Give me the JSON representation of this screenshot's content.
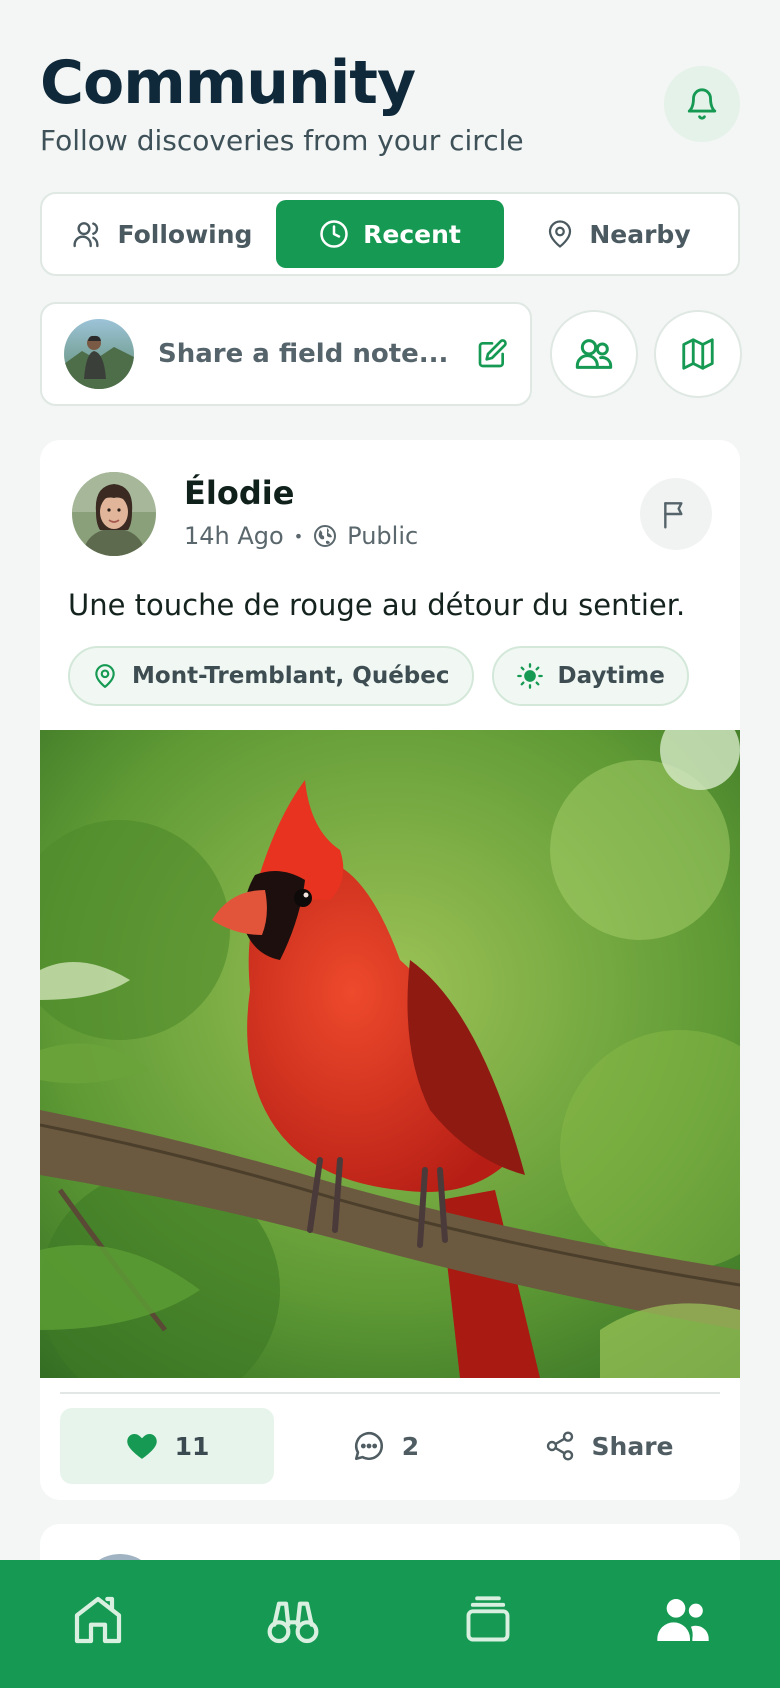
{
  "header": {
    "title": "Community",
    "subtitle": "Follow discoveries from your circle",
    "bell_icon": "bell-icon"
  },
  "tabs": [
    {
      "label": "Following",
      "icon": "users-icon",
      "active": false
    },
    {
      "label": "Recent",
      "icon": "clock-icon",
      "active": true
    },
    {
      "label": "Nearby",
      "icon": "map-pin-icon",
      "active": false
    }
  ],
  "composer": {
    "placeholder": "Share a field note...",
    "edit_icon": "edit-icon"
  },
  "quick_actions": [
    "group-icon",
    "map-icon"
  ],
  "post": {
    "author": "Élodie",
    "time": "14h Ago",
    "separator": "•",
    "visibility": "Public",
    "caption": "Une touche de rouge au détour du sentier.",
    "chips": [
      {
        "label": "Mont-Tremblant, Québec",
        "icon": "map-pin-icon"
      },
      {
        "label": "Daytime",
        "icon": "sun-icon"
      }
    ],
    "likes": "11",
    "comments": "2",
    "share_label": "Share"
  },
  "nav": [
    "home-icon",
    "binoculars-icon",
    "collection-icon",
    "community-icon"
  ],
  "colors": {
    "brand": "#169a53",
    "background": "#f3f6f4",
    "title": "#10293a"
  }
}
